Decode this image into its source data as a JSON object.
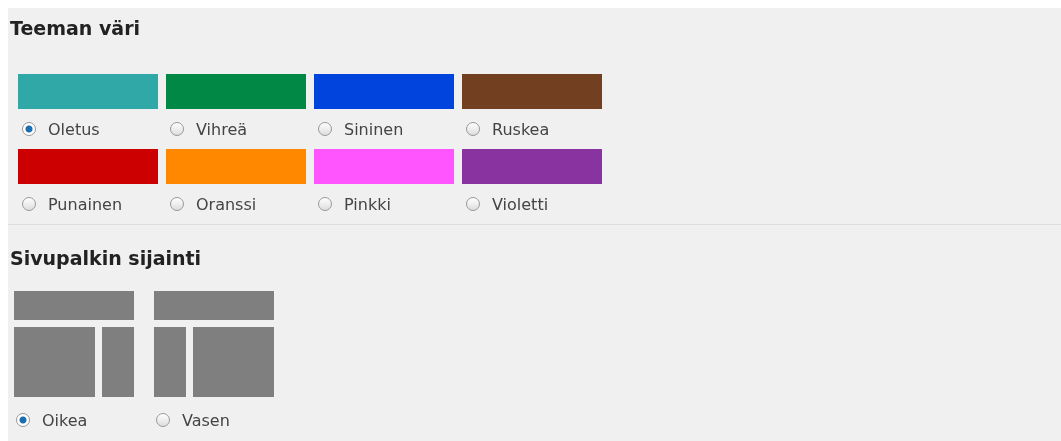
{
  "theme_color": {
    "title": "Teeman väri",
    "options": [
      {
        "label": "Oletus",
        "color": "#31a8a8",
        "selected": true
      },
      {
        "label": "Vihreä",
        "color": "#008844",
        "selected": false
      },
      {
        "label": "Sininen",
        "color": "#0044dd",
        "selected": false
      },
      {
        "label": "Ruskea",
        "color": "#723f21",
        "selected": false
      },
      {
        "label": "Punainen",
        "color": "#cc0000",
        "selected": false
      },
      {
        "label": "Oranssi",
        "color": "#ff8800",
        "selected": false
      },
      {
        "label": "Pinkki",
        "color": "#ff55ff",
        "selected": false
      },
      {
        "label": "Violetti",
        "color": "#8833a0",
        "selected": false
      }
    ]
  },
  "sidebar_position": {
    "title": "Sivupalkin sijainti",
    "options": [
      {
        "label": "Oikea",
        "kind": "right",
        "selected": true
      },
      {
        "label": "Vasen",
        "kind": "left",
        "selected": false
      }
    ]
  }
}
